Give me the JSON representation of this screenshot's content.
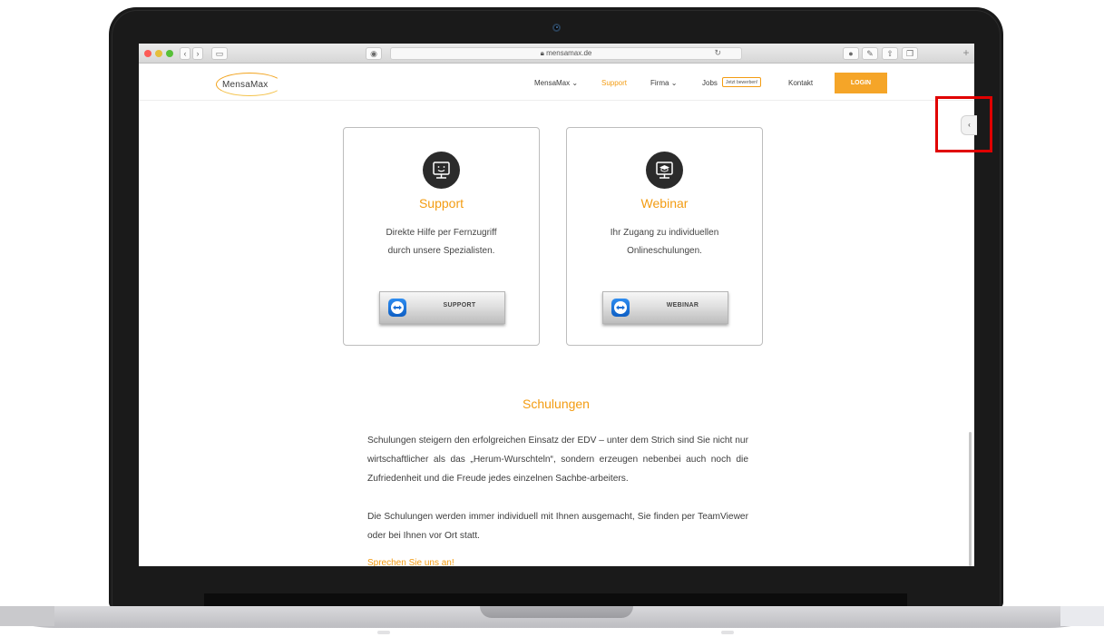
{
  "browser": {
    "url": "mensamax.de",
    "lock_icon": "lock-icon",
    "reload_icon": "reload-icon"
  },
  "site": {
    "logo": "MensaMax",
    "nav": [
      {
        "label": "MensaMax",
        "has_dropdown": true
      },
      {
        "label": "Support",
        "active": true
      },
      {
        "label": "Firma",
        "has_dropdown": true
      },
      {
        "label": "Jobs"
      },
      {
        "label": "Kontakt"
      }
    ],
    "jobs_badge": "Jetzt bewerben!",
    "login_label": "LOGIN",
    "accent_color": "#f39c12"
  },
  "cards": [
    {
      "title": "Support",
      "desc_line1": "Direkte Hilfe per Fernzugriff",
      "desc_line2": "durch unsere Spezialisten.",
      "button_label": "SUPPORT",
      "icon": "monitor-smiley-icon"
    },
    {
      "title": "Webinar",
      "desc_line1": "Ihr Zugang zu individuellen",
      "desc_line2": "Onlineschulungen.",
      "button_label": "WEBINAR",
      "icon": "monitor-graduation-icon"
    }
  ],
  "schulungen": {
    "title": "Schulungen",
    "para1": "Schulungen steigern den erfolgreichen Einsatz der EDV – unter dem Strich sind Sie nicht nur wirtschaftlicher als das „Herum-Wurschteln“, sondern erzeugen nebenbei auch noch die Zufriedenheit und die Freude jedes einzelnen Sachbe-arbeiters.",
    "para2": "Die Schulungen werden immer individuell mit Ihnen ausgemacht, Sie finden per TeamViewer oder bei Ihnen vor Ort statt.",
    "link": "Sprechen Sie uns an!"
  },
  "side_tab": {
    "glyph": "‹"
  }
}
